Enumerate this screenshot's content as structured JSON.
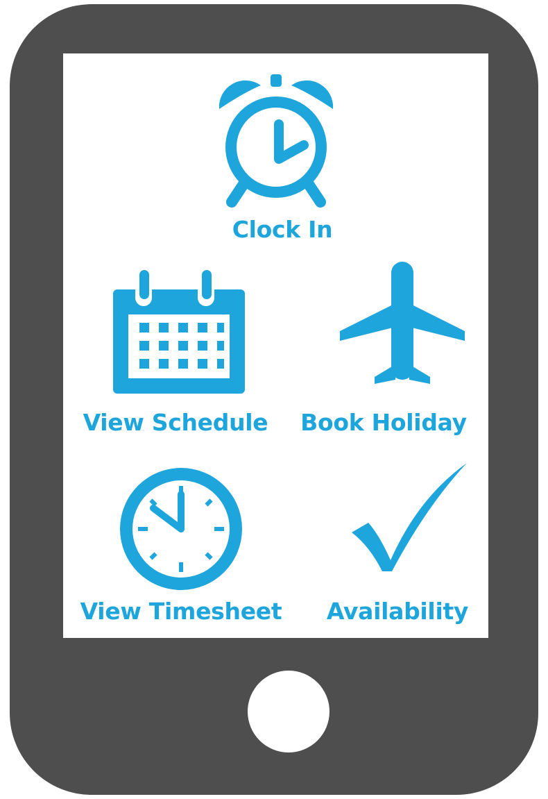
{
  "colors": {
    "device_body": "#4e4e4e",
    "screen": "#ffffff",
    "accent": "#1da5dc"
  },
  "menu": {
    "clock_in": {
      "label": "Clock In",
      "icon": "alarm-clock-icon"
    },
    "view_schedule": {
      "label": "View Schedule",
      "icon": "calendar-icon"
    },
    "book_holiday": {
      "label": "Book Holiday",
      "icon": "airplane-icon"
    },
    "view_timesheet": {
      "label": "View Timesheet",
      "icon": "clock-icon"
    },
    "availability": {
      "label": "Availability",
      "icon": "checkmark-icon"
    }
  }
}
